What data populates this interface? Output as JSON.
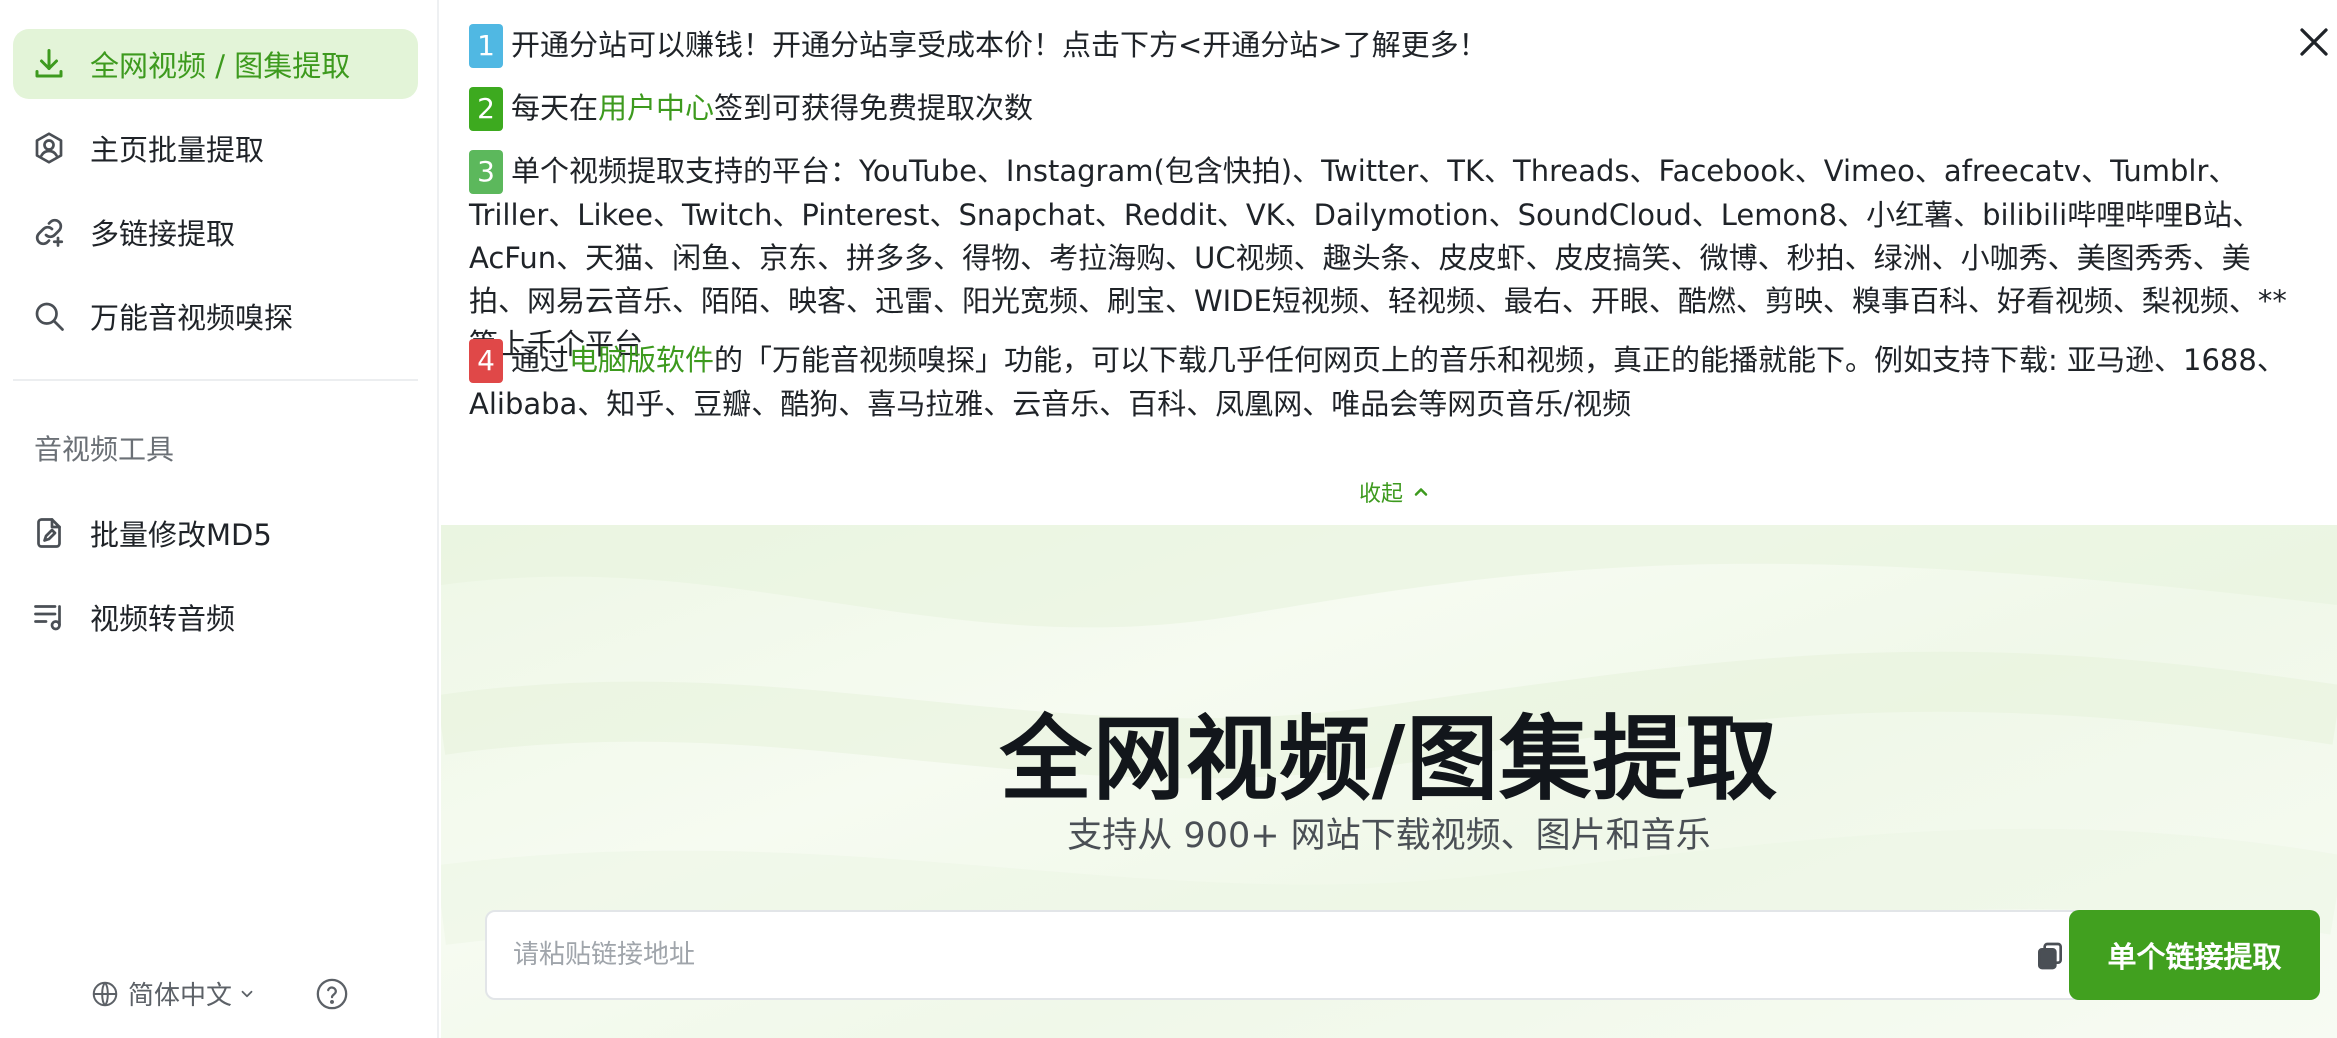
{
  "sidebar": {
    "nav": [
      {
        "label": "全网视频 / 图集提取",
        "icon": "download-icon"
      },
      {
        "label": "主页批量提取",
        "icon": "user-profile-icon"
      },
      {
        "label": "多链接提取",
        "icon": "link-icon"
      },
      {
        "label": "万能音视频嗅探",
        "icon": "search-icon"
      }
    ],
    "section_title": "音视频工具",
    "tools": [
      {
        "label": "批量修改MD5",
        "icon": "file-edit-icon"
      },
      {
        "label": "视频转音频",
        "icon": "music-list-icon"
      }
    ],
    "language": "简体中文"
  },
  "notice": {
    "items": [
      {
        "num": "1",
        "text": "开通分站可以赚钱！开通分站享受成本价！点击下方<开通分站>了解更多！"
      },
      {
        "num": "2",
        "text_before": "每天在",
        "link": "用户中心",
        "text_after": "签到可获得免费提取次数"
      },
      {
        "num": "3",
        "text": "单个视频提取支持的平台：YouTube、Instagram(包含快拍)、Twitter、TK、Threads、Facebook、Vimeo、afreecatv、Tumblr、Triller、Likee、Twitch、Pinterest、Snapchat、Reddit、VK、Dailymotion、SoundCloud、Lemon8、小红薯、bilibili哔哩哔哩B站、AcFun、天猫、闲鱼、京东、拼多多、得物、考拉海购、UC视频、趣头条、皮皮虾、皮皮搞笑、微博、秒拍、绿洲、小咖秀、美图秀秀、美拍、网易云音乐、陌陌、映客、迅雷、阳光宽频、刷宝、WIDE短视频、轻视频、最右、开眼、酷燃、剪映、糗事百科、好看视频、梨视频、**等上千个平台"
      },
      {
        "num": "4",
        "text_before": "通过",
        "link": "电脑版软件",
        "text_after": "的「万能音视频嗅探」功能，可以下载几乎任何网页上的音乐和视频，真正的能播就能下。例如支持下载: 亚马逊、1688、Alibaba、知乎、豆瓣、酷狗、喜马拉雅、云音乐、百科、凤凰网、唯品会等网页音乐/视频"
      }
    ],
    "collapse_label": "收起"
  },
  "hero": {
    "title": "全网视频/图集提取",
    "subtitle": "支持从 900+ 网站下载视频、图片和音乐",
    "input_placeholder": "请粘贴链接地址",
    "input_value": "",
    "button_label": "单个链接提取"
  },
  "colors": {
    "accent": "#41a01f",
    "active_bg": "#e3f4d8",
    "num1": "#50b8e3",
    "num2": "#3daa1f",
    "num3": "#5cb85c",
    "num4": "#e04848"
  }
}
